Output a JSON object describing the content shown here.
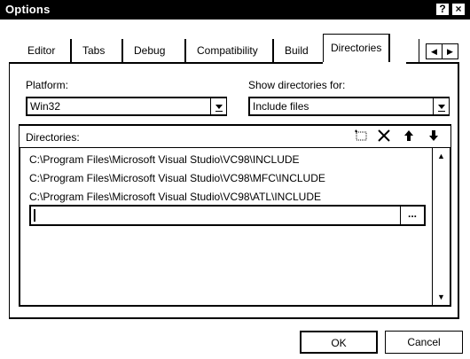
{
  "window": {
    "title": "Options",
    "help_label": "?",
    "close_label": "×"
  },
  "tabs": [
    {
      "label": "Editor"
    },
    {
      "label": "Tabs"
    },
    {
      "label": "Debug"
    },
    {
      "label": "Compatibility"
    },
    {
      "label": "Build"
    },
    {
      "label": "Directories",
      "active": true
    }
  ],
  "platform": {
    "label": "Platform:",
    "value": "Win32"
  },
  "show_dirs": {
    "label": "Show directories for:",
    "value": "Include files"
  },
  "directories": {
    "label": "Directories:",
    "items": [
      "C:\\Program Files\\Microsoft Visual Studio\\VC98\\INCLUDE",
      "C:\\Program Files\\Microsoft Visual Studio\\VC98\\MFC\\INCLUDE",
      "C:\\Program Files\\Microsoft Visual Studio\\VC98\\ATL\\INCLUDE"
    ],
    "edit_value": "",
    "browse_label": "..."
  },
  "toolbar_icons": [
    "new-folder-icon",
    "delete-icon",
    "move-up-icon",
    "move-down-icon"
  ],
  "buttons": {
    "ok": "OK",
    "cancel": "Cancel"
  }
}
